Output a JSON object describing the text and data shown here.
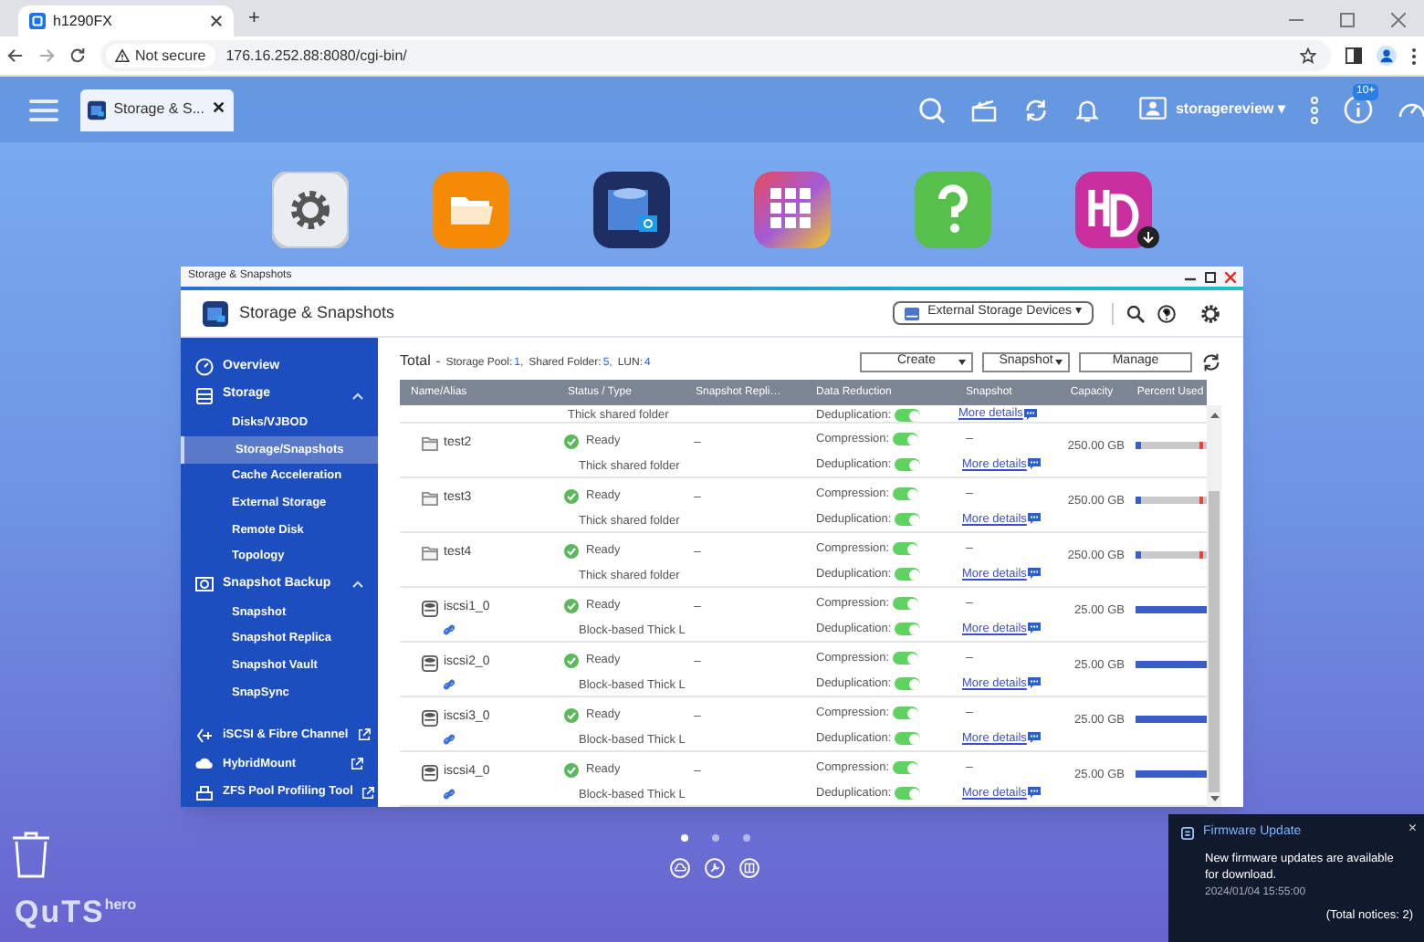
{
  "browser": {
    "tab_title": "h1290FX",
    "new_tab": "+",
    "security": "Not secure",
    "url": "176.16.252.88:8080/cgi-bin/"
  },
  "top_bar": {
    "task": {
      "label": "Storage & S...",
      "close": "✕"
    },
    "user": "storagereview ▾",
    "badge": "10+"
  },
  "desktop_icons": [
    {
      "kind": "control"
    },
    {
      "kind": "files"
    },
    {
      "kind": "storage"
    },
    {
      "kind": "apps"
    },
    {
      "kind": "help"
    },
    {
      "kind": "hdmi"
    }
  ],
  "window": {
    "title": "Storage & Snapshots",
    "app_title": "Storage & Snapshots",
    "device_dropdown": "External Storage Devices ▾",
    "sidebar": [
      {
        "label": "Overview"
      },
      {
        "label": "Storage",
        "expanded": true,
        "children": [
          {
            "label": "Disks/VJBOD",
            "selected": false
          },
          {
            "label": "Storage/Snapshots",
            "selected": true
          },
          {
            "label": "Cache Acceleration",
            "selected": false
          },
          {
            "label": "External Storage",
            "selected": false
          },
          {
            "label": "Remote Disk",
            "selected": false
          },
          {
            "label": "Topology",
            "selected": false
          }
        ]
      },
      {
        "label": "Snapshot Backup",
        "expanded": true,
        "children": [
          {
            "label": "Snapshot",
            "selected": false
          },
          {
            "label": "Snapshot Replica",
            "selected": false
          },
          {
            "label": "Snapshot Vault",
            "selected": false
          },
          {
            "label": "SnapSync",
            "selected": false
          }
        ]
      },
      {
        "label": "iSCSI & Fibre Channel",
        "external": true
      },
      {
        "label": "HybridMount",
        "external": true
      },
      {
        "label": "ZFS Pool Profiling Tool",
        "external": true
      }
    ],
    "summary": {
      "title": "Total",
      "dash": "-",
      "items": [
        {
          "label": "Storage Pool:",
          "value": "1,"
        },
        {
          "label": "Shared Folder:",
          "value": "5,"
        },
        {
          "label": "LUN:",
          "value": "4"
        }
      ]
    },
    "actions": [
      {
        "label": "Create",
        "dropdown": true
      },
      {
        "label": "Snapshot",
        "dropdown": true
      },
      {
        "label": "Manage",
        "dropdown": false
      }
    ],
    "table": {
      "columns": [
        "Name/Alias",
        "Status / Type",
        "Snapshot Repli…",
        "Data Reduction",
        "Snapshot",
        "Capacity",
        "Percent Used"
      ],
      "partial_row": {
        "type": "Thick shared folder",
        "dedup_label": "Deduplication:",
        "dedup_on": true,
        "link": "More details"
      },
      "rows": [
        {
          "kind": "folder",
          "name": "test2",
          "status": "Ready",
          "type": "Thick shared folder",
          "replica": "–",
          "comp_label": "Compression:",
          "comp_on": true,
          "dedup_label": "Deduplication:",
          "dedup_on": true,
          "snapshot": "–",
          "link": "More details",
          "capacity": "250.00 GB",
          "level": 0.06
        },
        {
          "kind": "folder",
          "name": "test3",
          "status": "Ready",
          "type": "Thick shared folder",
          "replica": "–",
          "comp_label": "Compression:",
          "comp_on": true,
          "dedup_label": "Deduplication:",
          "dedup_on": true,
          "snapshot": "–",
          "link": "More details",
          "capacity": "250.00 GB",
          "level": 0.06
        },
        {
          "kind": "folder",
          "name": "test4",
          "status": "Ready",
          "type": "Thick shared folder",
          "replica": "–",
          "comp_label": "Compression:",
          "comp_on": true,
          "dedup_label": "Deduplication:",
          "dedup_on": true,
          "snapshot": "–",
          "link": "More details",
          "capacity": "250.00 GB",
          "level": 0.06
        },
        {
          "kind": "lun",
          "name": "iscsi1_0",
          "status": "Ready",
          "type": "Block-based Thick L",
          "replica": "–",
          "comp_label": "Compression:",
          "comp_on": true,
          "dedup_label": "Deduplication:",
          "dedup_on": true,
          "snapshot": "–",
          "link": "More details",
          "capacity": "25.00 GB",
          "level": 1
        },
        {
          "kind": "lun",
          "name": "iscsi2_0",
          "status": "Ready",
          "type": "Block-based Thick L",
          "replica": "–",
          "comp_label": "Compression:",
          "comp_on": true,
          "dedup_label": "Deduplication:",
          "dedup_on": true,
          "snapshot": "–",
          "link": "More details",
          "capacity": "25.00 GB",
          "level": 1
        },
        {
          "kind": "lun",
          "name": "iscsi3_0",
          "status": "Ready",
          "type": "Block-based Thick L",
          "replica": "–",
          "comp_label": "Compression:",
          "comp_on": true,
          "dedup_label": "Deduplication:",
          "dedup_on": true,
          "snapshot": "–",
          "link": "More details",
          "capacity": "25.00 GB",
          "level": 1
        },
        {
          "kind": "lun",
          "name": "iscsi4_0",
          "status": "Ready",
          "type": "Block-based Thick L",
          "replica": "–",
          "comp_label": "Compression:",
          "comp_on": true,
          "dedup_label": "Deduplication:",
          "dedup_on": true,
          "snapshot": "–",
          "link": "More details",
          "capacity": "25.00 GB",
          "level": 1
        }
      ]
    }
  },
  "dock": {
    "logo": "QuTS",
    "logo_sup": "hero",
    "pages": [
      {
        "selected": true
      },
      {
        "selected": false
      },
      {
        "selected": false
      }
    ]
  },
  "notification": {
    "title": "Firmware Update",
    "close": "×",
    "message": "New firmware updates are available for download.",
    "time": "2024/01/04 15:55:00",
    "total": "(Total notices: 2)"
  }
}
